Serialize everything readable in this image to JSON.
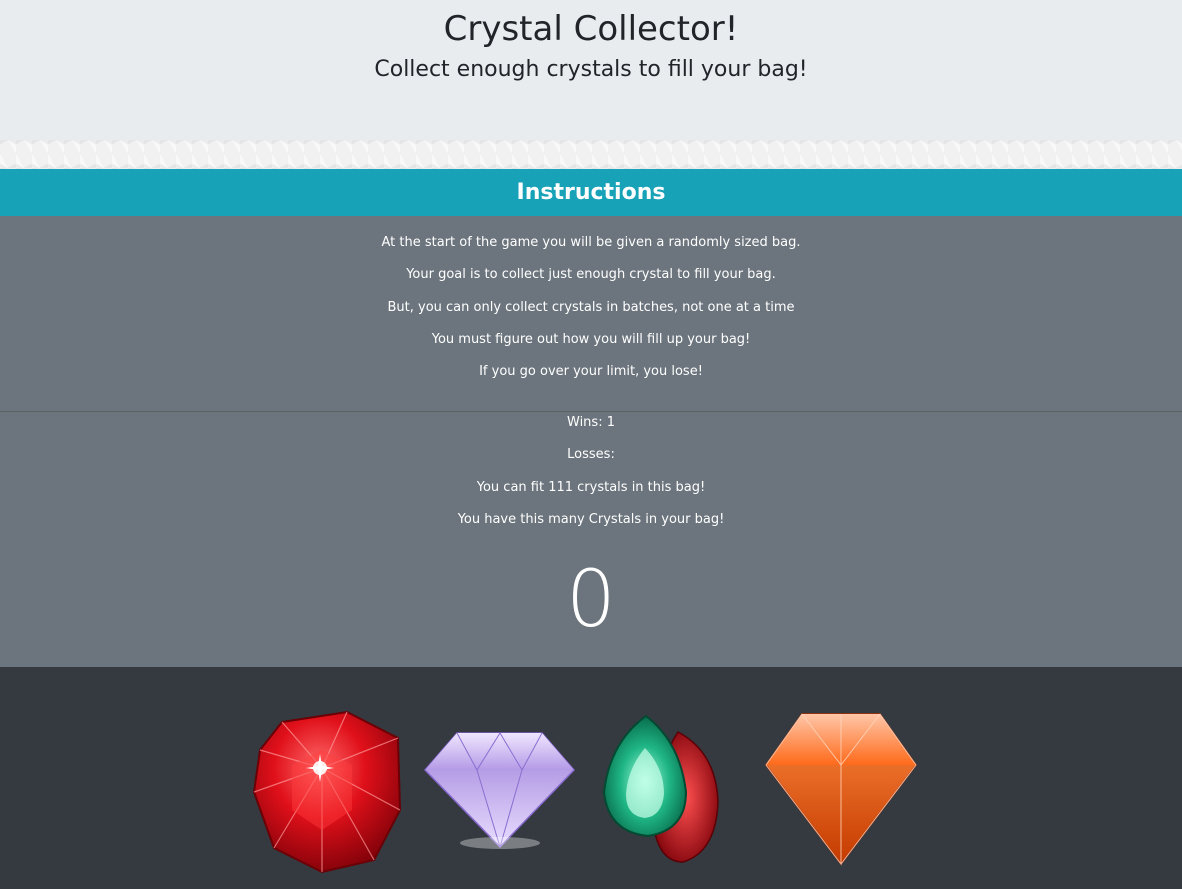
{
  "header": {
    "title": "Crystal Collector!",
    "subtitle": "Collect enough crystals to fill your bag!"
  },
  "instructions": {
    "heading": "Instructions",
    "lines": [
      "At the start of the game you will be given a randomly sized bag.",
      "Your goal is to collect just enough crystal to fill your bag.",
      "But, you can only collect crystals in batches, not one at a time",
      "You must figure out how you will fill up your bag!",
      "If you go over your limit, you lose!"
    ]
  },
  "stats": {
    "wins": "Wins: 1",
    "losses": "Losses:",
    "bag_capacity": "You can fit 111 crystals in this bag!",
    "bag_label": "You have this many Crystals in your bag!",
    "current_total": "0"
  },
  "crystals": [
    {
      "name": "red-ruby-crystal",
      "color": "#e0101a"
    },
    {
      "name": "purple-diamond-crystal",
      "color": "#b49ae6"
    },
    {
      "name": "green-emerald-crystal",
      "color": "#1fb585"
    },
    {
      "name": "orange-topaz-crystal",
      "color": "#ff6a1a"
    }
  ],
  "colors": {
    "header_bg": "#e9ecef",
    "instructions_header_bg": "#17a2b8",
    "body_bg": "#6c757d",
    "crystal_area_bg": "#343a40"
  }
}
